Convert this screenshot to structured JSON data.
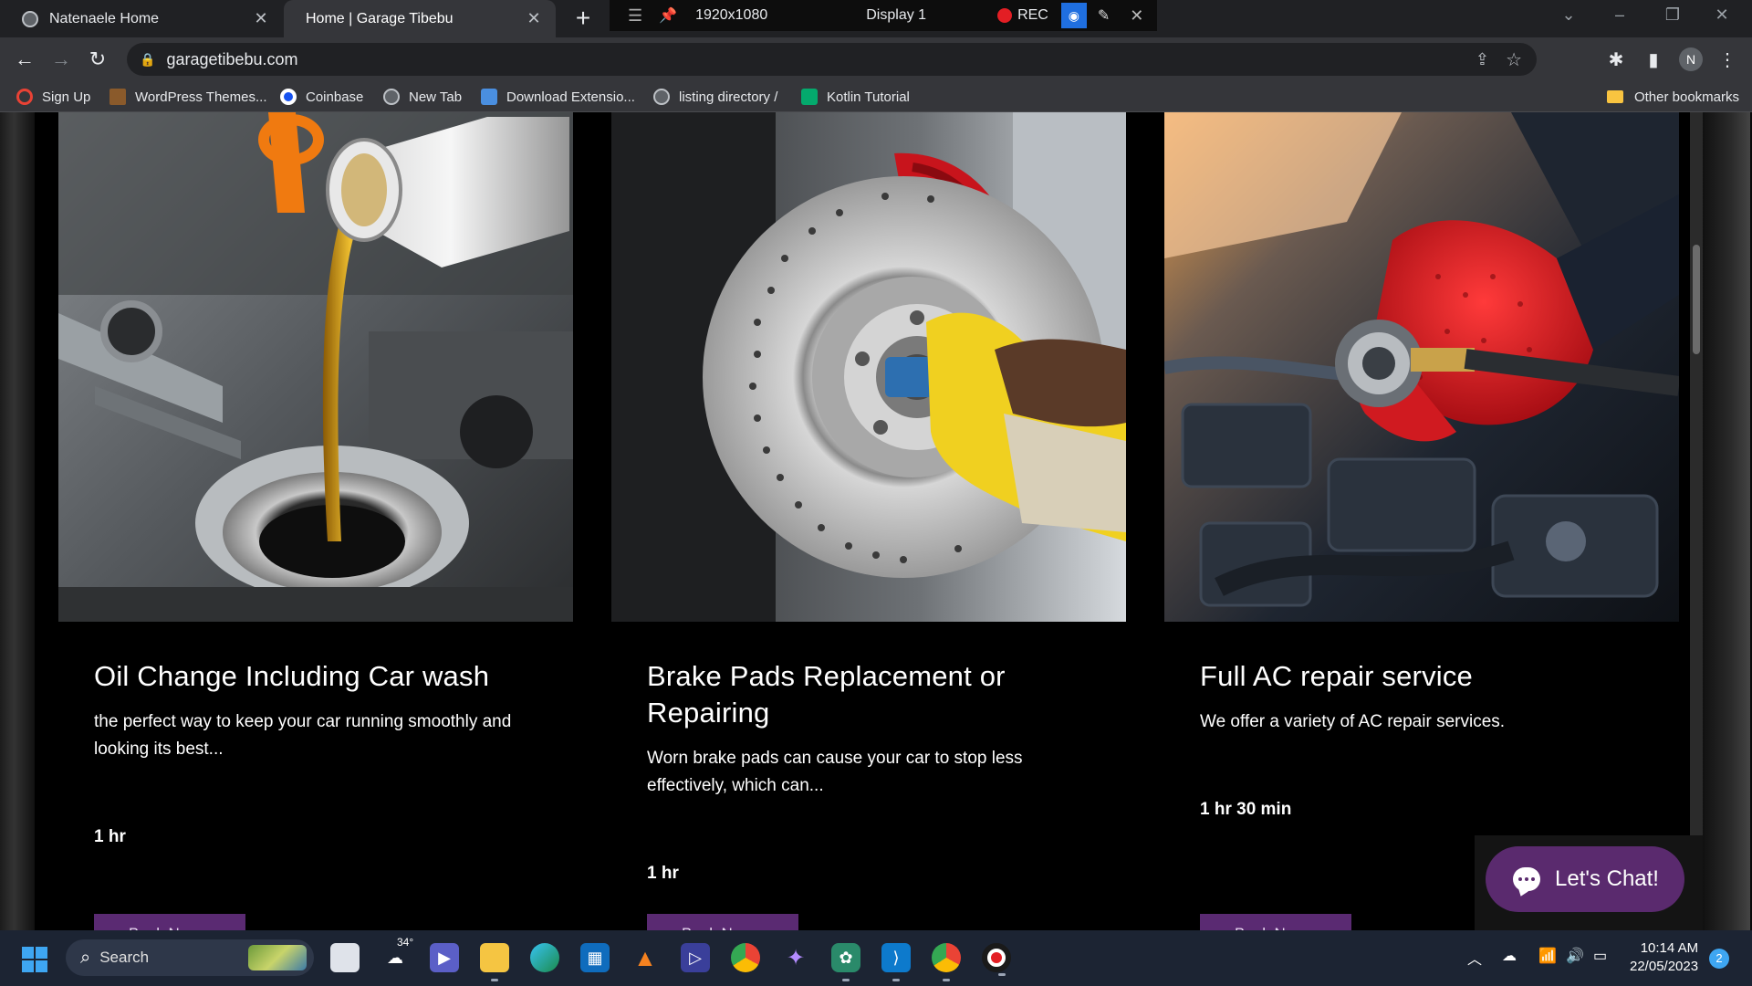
{
  "browser": {
    "tabs": [
      {
        "title": "Natenaele Home",
        "active": false
      },
      {
        "title": "Home | Garage Tibebu",
        "active": true
      }
    ],
    "recorder": {
      "resolution": "1920x1080",
      "display": "Display 1",
      "rec_label": "REC"
    },
    "url": "garagetibebu.com",
    "avatar_initial": "N",
    "bookmarks": [
      {
        "label": "Sign Up",
        "icon": "ring-icon"
      },
      {
        "label": "WordPress Themes...",
        "icon": "wordpress-icon"
      },
      {
        "label": "Coinbase",
        "icon": "coinbase-icon"
      },
      {
        "label": "New Tab",
        "icon": "globe-icon"
      },
      {
        "label": "Download Extensio...",
        "icon": "download-icon"
      },
      {
        "label": "listing directory /",
        "icon": "globe-icon"
      },
      {
        "label": "Kotlin Tutorial",
        "icon": "w3schools-icon"
      }
    ],
    "other_bookmarks": "Other bookmarks"
  },
  "services": [
    {
      "title": "Oil Change Including Car wash",
      "description": "the perfect way to keep your car running smoothly and looking its best...",
      "duration": "1 hr",
      "button": "Book Now"
    },
    {
      "title": "Brake Pads Replacement or Repairing",
      "description": "Worn brake pads can cause your car to stop less effectively, which can...",
      "duration": "1 hr",
      "button": "Book Now"
    },
    {
      "title": "Full AC repair service",
      "description": "We offer a variety of AC repair services.",
      "duration": "1 hr 30 min",
      "button": "Book Now"
    }
  ],
  "chat": {
    "label": "Let's Chat!"
  },
  "taskbar": {
    "search_placeholder": "Search",
    "weather_temp": "34°",
    "time": "10:14 AM",
    "date": "22/05/2023",
    "notification_count": "2"
  },
  "colors": {
    "accent_purple": "#5a2a6e",
    "page_bg": "#000000"
  }
}
